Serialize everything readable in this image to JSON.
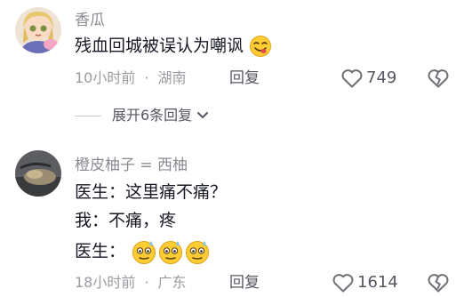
{
  "comments": [
    {
      "username": "香瓜",
      "text": "残血回城被误认为嘲讽",
      "time": "10小时前",
      "location": "湖南",
      "reply_label": "回复",
      "likes": "749",
      "expand_label": "展开6条回复"
    },
    {
      "username": "橙皮柚子 = 西柚",
      "lines": [
        "医生：这里痛不痛？",
        "我：不痛，疼",
        "医生："
      ],
      "time": "18小时前",
      "location": "广东",
      "reply_label": "回复",
      "likes": "1614"
    }
  ],
  "icons": {
    "like": "heart-outline-icon",
    "dislike": "broken-heart-icon",
    "emoji_inline": "yum-face-emoji",
    "emoji_triple": "sweating-face-emoji",
    "expand": "chevron-down-icon"
  },
  "colors": {
    "primary_text": "#161823",
    "secondary_text": "#8a8b91",
    "meta_text": "#9b9ca1",
    "emoji_yellow": "#ffcc33"
  }
}
